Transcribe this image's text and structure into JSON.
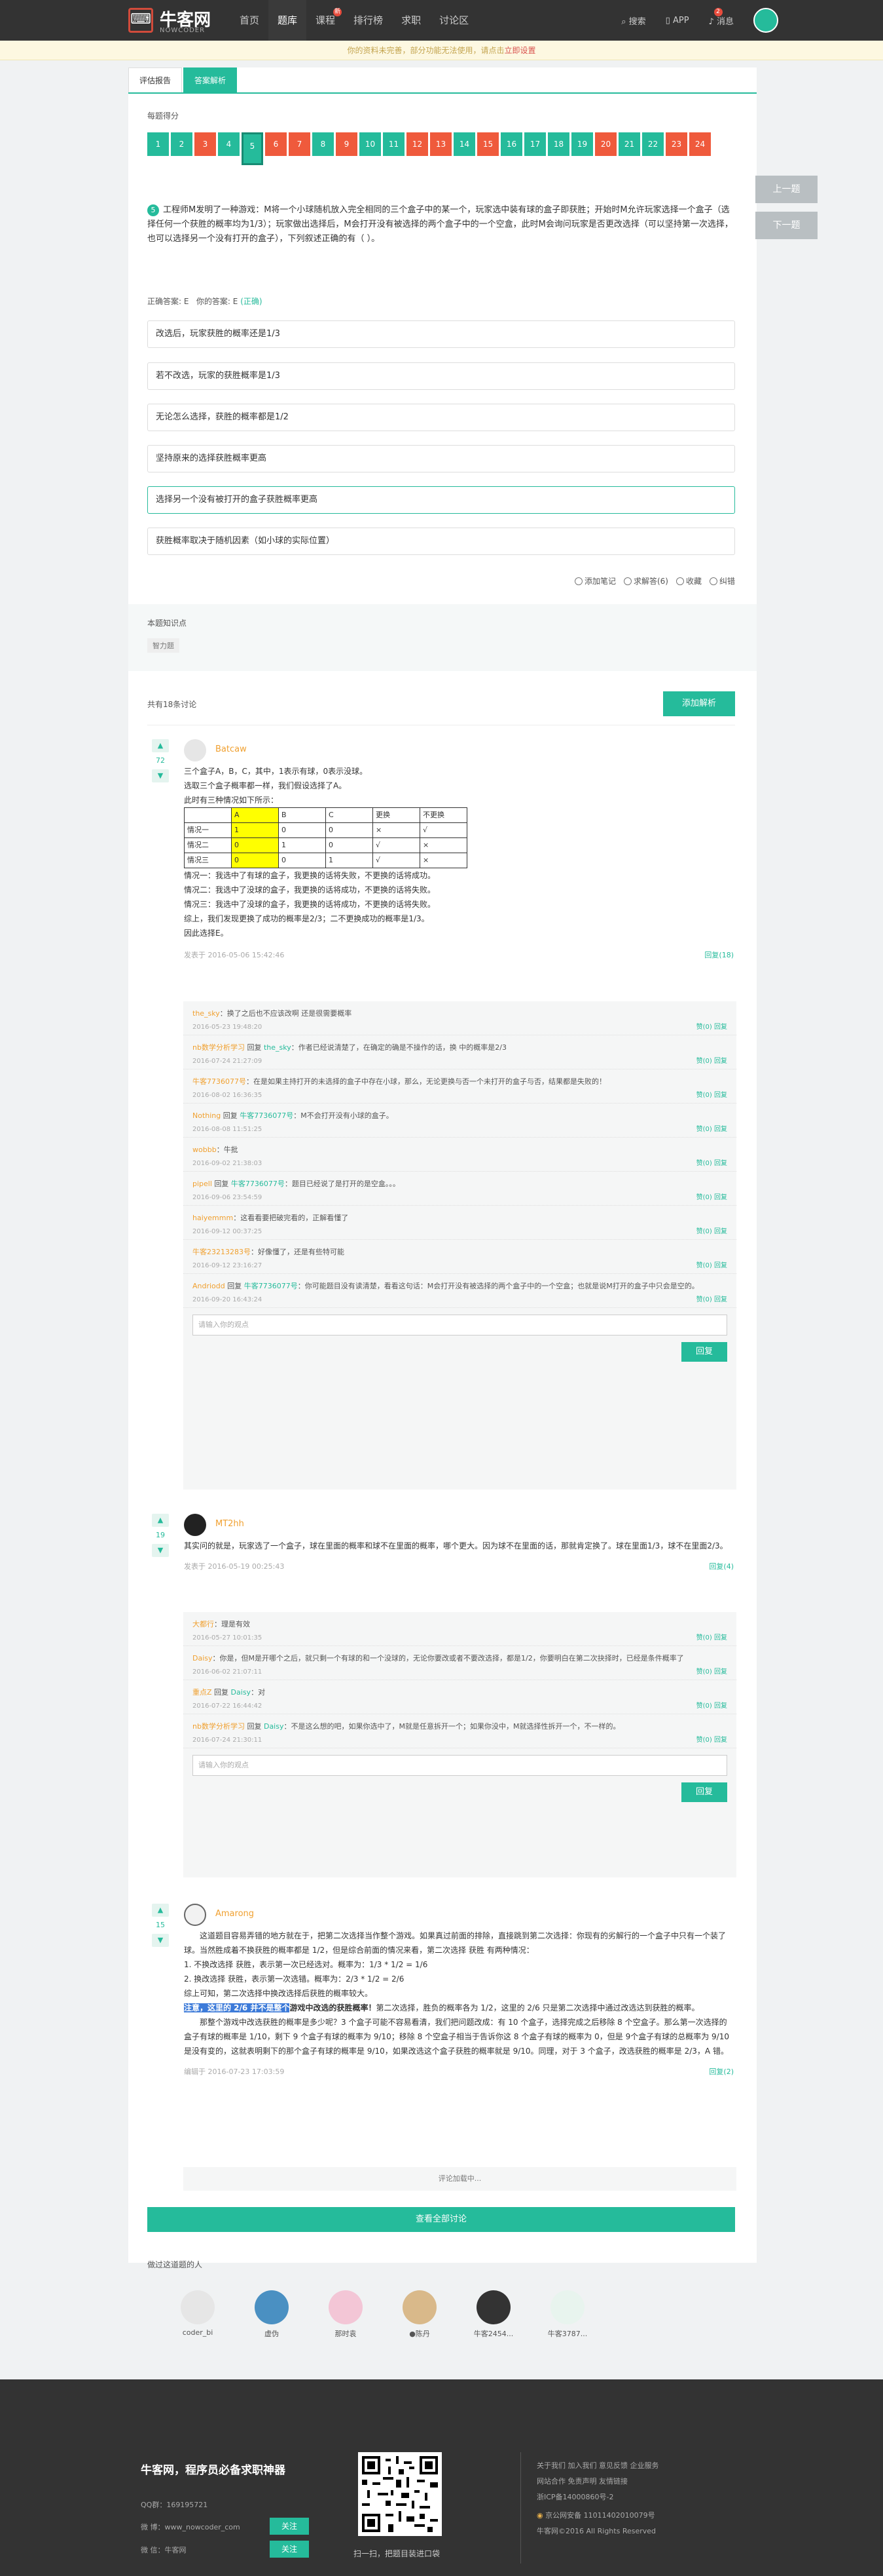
{
  "header": {
    "logo_mark": "⌨",
    "logo_name": "牛客网",
    "logo_sub": "NOWCODER",
    "nav": [
      "首页",
      "题库",
      "课程",
      "排行榜",
      "求职",
      "讨论区"
    ],
    "nav_badge": "新",
    "search": "搜索",
    "app": "APP",
    "messages": "消息",
    "msg_count": "2"
  },
  "notice": {
    "text": "你的资料未完善，部分功能无法使用，请点击",
    "link": "立即设置"
  },
  "tabs": [
    "评估报告",
    "答案解析"
  ],
  "scores": {
    "title": "每题得分",
    "items": [
      {
        "n": "1",
        "c": "g"
      },
      {
        "n": "2",
        "c": "g"
      },
      {
        "n": "3",
        "c": "r"
      },
      {
        "n": "4",
        "c": "g"
      },
      {
        "n": "5",
        "c": "g",
        "cur": true
      },
      {
        "n": "6",
        "c": "r"
      },
      {
        "n": "7",
        "c": "r"
      },
      {
        "n": "8",
        "c": "g"
      },
      {
        "n": "9",
        "c": "r"
      },
      {
        "n": "10",
        "c": "g"
      },
      {
        "n": "11",
        "c": "g"
      },
      {
        "n": "12",
        "c": "r"
      },
      {
        "n": "13",
        "c": "r"
      },
      {
        "n": "14",
        "c": "g"
      },
      {
        "n": "15",
        "c": "r"
      },
      {
        "n": "16",
        "c": "g"
      },
      {
        "n": "17",
        "c": "g"
      },
      {
        "n": "18",
        "c": "g"
      },
      {
        "n": "19",
        "c": "g"
      },
      {
        "n": "20",
        "c": "r"
      },
      {
        "n": "21",
        "c": "g"
      },
      {
        "n": "22",
        "c": "g"
      },
      {
        "n": "23",
        "c": "r"
      },
      {
        "n": "24",
        "c": "r"
      }
    ]
  },
  "side": {
    "prev": "上一题",
    "next": "下一题"
  },
  "question": {
    "num": "5",
    "text": "工程师M发明了一种游戏：M将一个小球随机放入完全相同的三个盒子中的某一个，玩家选中装有球的盒子即获胜；开始时M允许玩家选择一个盒子（选择任何一个获胜的概率均为1/3）；玩家做出选择后，M会打开没有被选择的两个盒子中的一个空盒，此时M会询问玩家是否更改选择（可以坚持第一次选择，也可以选择另一个没有打开的盒子），下列叙述正确的有（ ）。"
  },
  "answer": {
    "correct_label": "正确答案: E",
    "yours_label": "你的答案: E",
    "status": "(正确)"
  },
  "options": [
    "改选后，玩家获胜的概率还是1/3",
    "若不改选，玩家的获胜概率是1/3",
    "无论怎么选择，获胜的概率都是1/2",
    "坚持原来的选择获胜概率更高",
    "选择另一个没有被打开的盒子获胜概率更高",
    "获胜概率取决于随机因素（如小球的实际位置）"
  ],
  "tools": [
    "添加笔记",
    "求解答(6)",
    "收藏",
    "纠错"
  ],
  "knowledge": {
    "title": "本题知识点",
    "tag": "智力题"
  },
  "discussion": {
    "count": "共有18条讨论",
    "add": "添加解析"
  },
  "comments": [
    {
      "votes": "72",
      "name": "Batcaw",
      "lines": [
        "三个盒子A，B，C，其中，1表示有球，0表示没球。",
        "选取三个盒子概率都一样，我们假设选择了A。",
        "此时有三种情况如下所示："
      ],
      "table": [
        [
          "",
          "A",
          "B",
          "C",
          "更换",
          "不更换"
        ],
        [
          "情况一",
          "1",
          "0",
          "0",
          "×",
          "√"
        ],
        [
          "情况二",
          "0",
          "1",
          "0",
          "√",
          "×"
        ],
        [
          "情况三",
          "0",
          "0",
          "1",
          "√",
          "×"
        ]
      ],
      "after": [
        "情况一：我选中了有球的盒子，我更换的话将失败，不更换的话将成功。",
        "情况二：我选中了没球的盒子，我更换的话将成功，不更换的话将失败。",
        "情况三：我选中了没球的盒子，我更换的话将成功，不更换的话将失败。",
        "综上，我们发现更换了成功的概率是2/3；二不更换成功的概率是1/3。",
        "因此选择E。"
      ],
      "time": "发表于 2016-05-06 15:42:46",
      "reply": "回复(18)"
    },
    {
      "votes": "19",
      "name": "MT2hh",
      "lines": [
        "其实问的就是，玩家选了一个盒子，球在里面的概率和球不在里面的概率，哪个更大。因为球不在里面的话，那就肯定换了。球在里面1/3，球不在里面2/3。"
      ],
      "time": "发表于 2016-05-19 00:25:43",
      "reply": "回复(4)"
    },
    {
      "votes": "15",
      "name": "Amarong",
      "lines": [
        "这道题目容易弄错的地方就在于，把第二次选择当作整个游戏。如果真过前面的排除，直接跳到第二次选择：你现有的劣解行的一个盒子中只有一个装了球。当然胜成着不换获胜的概率都是 1/2，但是综合前面的情况来看，第二次选择 获胜 有两种情况：",
        "1. 不换改选择 获胜，表示第一次已经选对。概率为：1/3 * 1/2 = 1/6",
        "2. 换改选择 获胜，表示第一次选错。概率为：2/3 * 1/2 = 2/6",
        "  综上可知，第二次选择中换改选择后获胜的概率较大。"
      ],
      "hl_text": "注意，这里的 2/6 并不是整个",
      "hl_after": "游戏中改选的获胜概率！",
      "more": "第二次选择，胜负的概率各为 1/2，这里的 2/6 只是第二次选择中通过改选达到获胜的概率。",
      "more2": "那整个游戏中改选获胜的概率是多少呢？3 个盒子可能不容易看清，我们把问题改成：有 10 个盒子，选择完成之后移除 8 个空盒子。那么第一次选择的盒子有球的概率是 1/10，剩下 9 个盒子有球的概率为 9/10；移除 8 个空盒子相当于告诉你这 8 个盒子有球的概率为 0，但是 9个盒子有球的总概率为 9/10 是没有变的，这就表明剩下的那个盒子有球的概率是 9/10，如果改选这个盒子获胜的概率就是 9/10。同理，对于 3 个盒子，改选获胜的概率是 2/3，A 错。",
      "time": "编辑于 2016-07-23 17:03:59",
      "reply": "回复(2)"
    }
  ],
  "sub1": [
    {
      "who": "the_sky",
      "to": "",
      "txt": "换了之后也不应该改啊 还是很需要概率",
      "tm": "2016-05-23 19:48:20",
      "acts": "赞(0)   回复"
    },
    {
      "who": "nb数学分析学习",
      "to": "the_sky",
      "txt": "作者已经说清楚了，在确定的确是不操作的话，换 中的概率是2/3",
      "tm": "2016-07-24 21:27:09",
      "acts": "赞(0)   回复"
    },
    {
      "who": "牛客7736077号",
      "to": "",
      "txt": "在是如果主持打开的未选择的盒子中存在小球，那么，无论更换与否一个未打开的盒子与否，结果都是失败的！",
      "tm": "2016-08-02 16:36:35",
      "acts": "赞(0)   回复"
    },
    {
      "who": "Nothing",
      "to": "牛客7736077号",
      "txt": "M不会打开没有小球的盒子。",
      "tm": "2016-08-08 11:51:25",
      "acts": "赞(0)   回复"
    },
    {
      "who": "wobbb",
      "to": "",
      "txt": "牛批",
      "tm": "2016-09-02 21:38:03",
      "acts": "赞(0)   回复"
    },
    {
      "who": "pipell",
      "to": "牛客7736077号",
      "txt": "题目已经说了是打开的是空盒。。。",
      "tm": "2016-09-06 23:54:59",
      "acts": "赞(0)   回复"
    },
    {
      "who": "haiyemmm",
      "to": "",
      "txt": "这看看要把破完看的，正解看懂了",
      "tm": "2016-09-12 00:37:25",
      "acts": "赞(0)   回复"
    },
    {
      "who": "牛客23213283号",
      "to": "",
      "txt": "好像懂了，还是有些特可能",
      "tm": "2016-09-12 23:16:27",
      "acts": "赞(0)   回复"
    },
    {
      "who": "Andriodd",
      "to": "牛客7736077号",
      "txt": "你可能题目没有读清楚，看看这句话：M会打开没有被选择的两个盒子中的一个空盒；也就是说M打开的盒子中只会是空的。",
      "tm": "2016-09-20 16:43:24",
      "acts": "赞(0)   回复"
    }
  ],
  "sub2": [
    {
      "who": "大都行",
      "to": "",
      "txt": "理是有效",
      "tm": "2016-05-27 10:01:35",
      "acts": "赞(0)   回复"
    },
    {
      "who": "Daisy",
      "to": "",
      "txt": "你是，但M是开哪个之后，就只剩一个有球的和一个没球的，无论你要改或者不要改选择，都是1/2，你要明白在第二次抉择时，已经是条件概率了",
      "tm": "2016-06-02 21:07:11",
      "acts": "赞(0)   回复"
    },
    {
      "who": "重点Z",
      "to": "Daisy",
      "txt": "对",
      "tm": "2016-07-22 16:44:42",
      "acts": "赞(0)   回复"
    },
    {
      "who": "nb数学分析学习",
      "to": "Daisy",
      "txt": "不是这么想的吧，如果你选中了，M就是任意拆开一个；如果你没中，M就选择性拆开一个，不一样的。",
      "tm": "2016-07-24 21:30:11",
      "acts": "赞(0)   回复"
    }
  ],
  "sub_input": "请输入你的观点",
  "reply_btn": "回复",
  "reply_word": "回复",
  "loading": "评论加载中...",
  "view_all": "查看全部讨论",
  "people": {
    "title": "做过这道题的人",
    "list": [
      "coder_bi",
      "虚伪",
      "那时袁",
      "●陈丹",
      "牛客2454...",
      "牛客3787..."
    ]
  },
  "footer": {
    "title": "牛客网，程序员必备求职神器",
    "qq": "QQ群：169195721",
    "weibo": "微 博：www_nowcoder_com",
    "wechat": "微 信：牛客网",
    "follow": "关注",
    "qr_caption": "扫一扫，把题目装进口袋",
    "links1": "关于我们   加入我们   意见反馈   企业服务",
    "links2": "网站合作   免责声明   友情链接",
    "icp": "浙ICP备14000860号-2",
    "police": "京公网安备 11011402010079号",
    "copy": "牛客网©2016 All Rights Reserved"
  },
  "colors": {
    "accent": "#25bb9b",
    "wrong": "#ef5a3c",
    "topbar": "#333333"
  }
}
